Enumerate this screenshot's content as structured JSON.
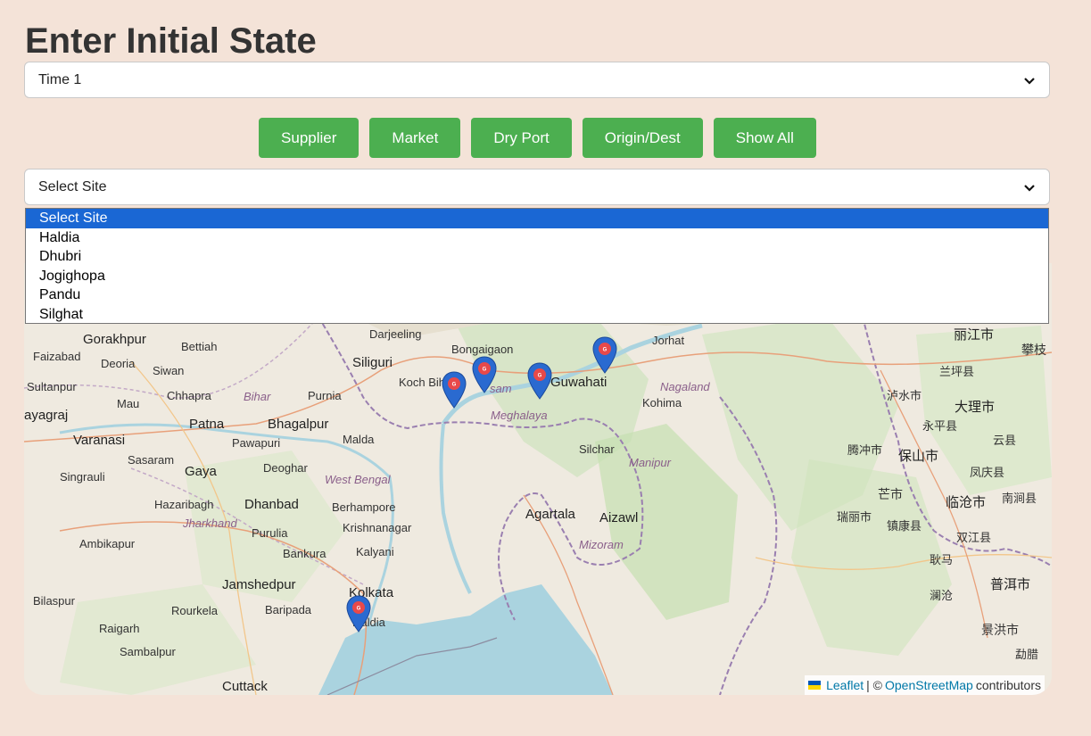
{
  "page": {
    "title": "Enter Initial State"
  },
  "time_select": {
    "value": "Time 1"
  },
  "buttons": {
    "supplier": "Supplier",
    "market": "Market",
    "dry_port": "Dry Port",
    "origin_dest": "Origin/Dest",
    "show_all": "Show All"
  },
  "site_select": {
    "value": "Select Site",
    "options": [
      "Select Site",
      "Haldia",
      "Dhubri",
      "Jogighopa",
      "Pandu",
      "Silghat"
    ]
  },
  "map": {
    "places": {
      "gorakhpur": "Gorakhpur",
      "bettiah": "Bettiah",
      "faizabad": "Faizabad",
      "deoria": "Deoria",
      "siwan": "Siwan",
      "sultanpur": "Sultanpur",
      "chhapra": "Chhapra",
      "mau": "Mau",
      "ayagraj": "ayagraj",
      "varanasi": "Varanasi",
      "patna": "Patna",
      "sasaram": "Sasaram",
      "gaya": "Gaya",
      "singrauli": "Singrauli",
      "hazaribagh": "Hazaribagh",
      "dhanbad": "Dhanbad",
      "ambikapur": "Ambikapur",
      "purulia": "Purulia",
      "bankura": "Bankura",
      "jamshedpur": "Jamshedpur",
      "bilaspur": "Bilaspur",
      "rourkela": "Rourkela",
      "baripada": "Baripada",
      "raigarh": "Raigarh",
      "sambalpur": "Sambalpur",
      "cuttack": "Cuttack",
      "darjeeling": "Darjeeling",
      "siliguri": "Siliguri",
      "purnia": "Purnia",
      "bhagalpur": "Bhagalpur",
      "pawapuri": "Pawapuri",
      "deoghar": "Deoghar",
      "malda": "Malda",
      "berhampore": "Berhampore",
      "krishnanagar": "Krishnanagar",
      "kalyani": "Kalyani",
      "kolkata": "Kolkata",
      "haldia": "Haldia",
      "koch_bihar": "Koch Bih",
      "bongaigaon": "Bongaigaon",
      "guwahati": "Guwahati",
      "jorhat": "Jorhat",
      "kohima": "Kohima",
      "agartala": "Agartala",
      "aizawl": "Aizawl",
      "silchar": "Silchar",
      "bihar": "Bihar",
      "jharkhand": "Jharkhand",
      "west_bengal": "West Bengal",
      "meghalaya": "Meghalaya",
      "nagaland": "Nagaland",
      "manipur": "Manipur",
      "mizoram": "Mizoram",
      "assam": "sam",
      "lijiang": "丽江市",
      "dali": "大理市",
      "baoshan": "保山市",
      "lincang": "临沧市",
      "puer": "普洱市",
      "jinghong": "景洪市",
      "yongping": "永平县",
      "tengchong": "腾冲市",
      "mangshi": "芒市",
      "lushui": "泸水市",
      "yunxian": "云县",
      "panzhihua": "攀枝",
      "gengma": "耿马",
      "shuangjiang": "双江县",
      "fengqing": "凤庆县",
      "nanjian": "南涧县",
      "ruili": "瑞丽市",
      "zhenkang": "镇康县",
      "lancang": "澜沧",
      "mengla": "勐腊",
      "lanping": "兰坪县"
    },
    "attribution": {
      "leaflet": "Leaflet",
      "separator": "| ©",
      "osm": "OpenStreetMap",
      "suffix": "contributors"
    },
    "markers": [
      "haldia-marker",
      "dhubri-marker",
      "jogighopa-marker",
      "pandu-marker",
      "silghat-marker"
    ]
  },
  "colors": {
    "background": "#f4e3d8",
    "button": "#4caf50",
    "marker": "#2a6ad0",
    "selected_option": "#1a67d4",
    "water": "#aad3df"
  }
}
